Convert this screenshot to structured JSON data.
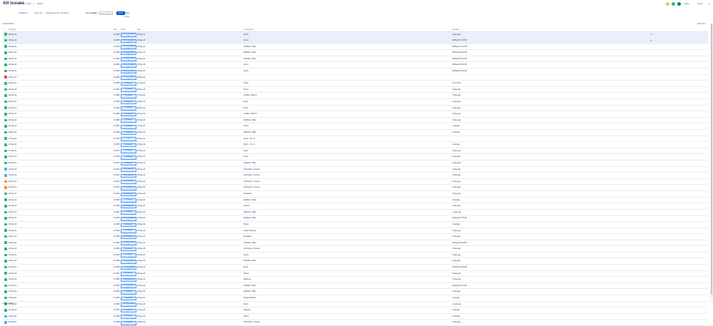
{
  "header": {
    "title": "All issues",
    "save_label": "Save",
    "share_label": "Share",
    "detail_label": "Details",
    "right_actions": [
      "Share",
      "Export",
      "•••"
    ],
    "status_dots": [
      "#f6c342",
      "#36b37e",
      "#00875a"
    ]
  },
  "filters": {
    "chips": [
      "All Status ▾",
      "Type: All ▾",
      "Assignee(s): Zhu Yun(exit) ▾",
      "Reporter: All ▾",
      "+ More"
    ],
    "search_placeholder": "Search issues",
    "search_button": "Search",
    "advanced_link": "Switch to JQL"
  },
  "list": {
    "count_label": "1-40 of 40 ⟳",
    "columns_label": "Columns ▾",
    "headers": [
      "T",
      "Summary",
      "Key",
      "Status",
      "Due",
      "Components",
      "Updated"
    ],
    "rows": [
      {
        "type": "story",
        "summary": "28-Sep-22",
        "key": "IC-3896",
        "status": "TODO ESTIMATE DATE",
        "due": "28-Sep-22",
        "component": "Scrum",
        "updated": "3 days ago"
      },
      {
        "type": "story",
        "summary": "28-Sep-22",
        "key": "IC-3895",
        "status": "TODO ESTIMATE DATE",
        "due": "28-Sep-22",
        "component": "Scrum",
        "updated": "28/Sep/22 3:25 PM"
      },
      {
        "type": "story",
        "summary": "28-Sep-22",
        "key": "IC-3894",
        "status": "TODO ESTIMATE DATE",
        "due": "28-Sep-22",
        "component": "Workflow / Table",
        "updated": "28/Sep/22 2:17 PM"
      },
      {
        "type": "story",
        "summary": "28-Sep-22",
        "key": "IC-3893",
        "status": "TODO ESTIMATE DATE",
        "due": "28-Sep-22",
        "component": "Workflow / Table",
        "updated": "28/Sep/22 2:06 PM"
      },
      {
        "type": "story",
        "summary": "28-Sep-22",
        "key": "IC-3892",
        "status": "TODO ESTIMATE DATE",
        "due": "28-Sep-22",
        "component": "Workflow / Table",
        "updated": "28/Sep/22 8:41 AM"
      },
      {
        "type": "story",
        "summary": "28-Sep-22",
        "key": "IC-3891",
        "status": "TODO ESTIMATE DATE",
        "due": "28-Sep-22",
        "component": "Scrum",
        "updated": "28/Sep/22 8:03 AM"
      },
      {
        "type": "story",
        "summary": "28-Sep-22",
        "key": "IC-3890",
        "status": "TODO ESTIMATE DATE",
        "due": "28-Sep-22",
        "component": "Scrum",
        "updated": "28/Sep/22 8:00 AM"
      },
      {
        "type": "bug",
        "summary": "28-Sep-22",
        "key": "IC-3889",
        "status": "TODO ESTIMATE DATE",
        "due": "28-Sep-22",
        "component": "",
        "updated": ""
      },
      {
        "type": "story",
        "summary": "28-Sep-22",
        "key": "IC-3888",
        "status": "IN DESIGN",
        "due": "11-Sep-22",
        "component": "Scrum",
        "updated": "21 17 Sims"
      },
      {
        "type": "story",
        "summary": "28-Sep-22",
        "key": "IC-3887",
        "status": "IN DESIGN",
        "due": "08-Sep-22",
        "component": "Scrum",
        "updated": "5 days ago"
      },
      {
        "type": "story",
        "summary": "28-Sep-22",
        "key": "IC-3886",
        "status": "IN DESIGN",
        "due": "07-Sep-22",
        "component": "Lockbox / Branch",
        "updated": "5 days ago"
      },
      {
        "type": "story",
        "summary": "28-Sep-22",
        "key": "IC-3885",
        "status": "IN DESIGN",
        "due": "06-Sep-22",
        "component": "Errors",
        "updated": "5 days ago"
      },
      {
        "type": "story",
        "summary": "28-Sep-22",
        "key": "IC-3884",
        "status": "IN DESIGN",
        "due": "06-Sep-22",
        "component": "Errors",
        "updated": "5 days ago"
      },
      {
        "type": "story",
        "summary": "28-Sep-22",
        "key": "IC-3883",
        "status": "IN DESIGN",
        "due": "06-Sep-22",
        "component": "Lockbox / Branch",
        "updated": "5 days ago"
      },
      {
        "type": "story",
        "summary": "28-Sep-22",
        "key": "IC-3882",
        "status": "IN DESIGN",
        "due": "06-Sep-22",
        "component": "Workflow / Table",
        "updated": "5 days ago"
      },
      {
        "type": "story",
        "summary": "28-Sep-22",
        "key": "IC-3881",
        "status": "IN DESIGN",
        "due": "06-Sep-22",
        "component": "Scrum",
        "updated": "Yesterday"
      },
      {
        "type": "story",
        "summary": "28-Sep-22",
        "key": "IC-3880",
        "status": "IN DESIGN",
        "due": "06-Sep-22",
        "component": "Workflow / Table",
        "updated": "Yesterday"
      },
      {
        "type": "story",
        "summary": "27-Sep-22",
        "key": "IC-3879",
        "status": "DEV",
        "due": "06-Sep-22",
        "component": "Sprint – 23 / 11",
        "updated": ""
      },
      {
        "type": "story",
        "summary": "27-Sep-22",
        "key": "IC-3878",
        "status": "IN DESIGN",
        "due": "06-Sep-22",
        "component": "Sprint – 23 / 11",
        "updated": "Yesterday"
      },
      {
        "type": "story",
        "summary": "27-Sep-22",
        "key": "IC-3877",
        "status": "IN DESIGN",
        "due": "07-Sep-22",
        "component": "Other",
        "updated": "5 days ago"
      },
      {
        "type": "story",
        "summary": "26-Sep-22",
        "key": "IC-3876",
        "status": "IN DESIGN",
        "due": "06-Sep-22",
        "component": "Scrum",
        "updated": "5 days ago"
      },
      {
        "type": "story",
        "summary": "26-Sep-22",
        "key": "IC-3875",
        "status": "IN DESIGN",
        "due": "06-Sep-22",
        "component": "Workflow / Table",
        "updated": "5 days ago"
      },
      {
        "type": "task",
        "summary": "26-Sep-22",
        "key": "IC-3874",
        "status": "IN ESTIMATION",
        "due": "06-Sep-22",
        "component": "Information / Courses",
        "updated": "5 days ago"
      },
      {
        "type": "task",
        "summary": "26-Sep-22",
        "key": "IC-3873",
        "status": "IN ESTIMATION",
        "due": "06-Sep-22",
        "component": "Information / Courses",
        "updated": "5 days ago"
      },
      {
        "type": "improve",
        "summary": "26-Sep-22",
        "key": "IC-3872",
        "status": "IN ESTIMATION",
        "due": "06-Sep-22",
        "component": "Information / Courses",
        "updated": "5 days ago"
      },
      {
        "type": "improve",
        "summary": "26-Sep-22",
        "key": "IC-3871",
        "status": "IN ESTIMATION",
        "due": "06-Sep-22",
        "component": "Information / Courses",
        "updated": "5 days ago"
      },
      {
        "type": "story",
        "summary": "26-Sep-22",
        "key": "IC-3870",
        "status": "IN ESTIMATION",
        "due": "06-Sep-22",
        "component": "Escalation",
        "updated": "5 days ago"
      },
      {
        "type": "story",
        "summary": "26-Sep-22",
        "key": "IC-3869",
        "status": "IN DESIGN",
        "due": "11-Sep-22",
        "component": "Workflow / Table",
        "updated": "Yesterday"
      },
      {
        "type": "story",
        "summary": "26-Sep-22",
        "key": "IC-3868",
        "status": "IN ESTIMATION",
        "due": "06-Sep-22",
        "component": "Security",
        "updated": "5 days ago"
      },
      {
        "type": "story",
        "summary": "26-Sep-22",
        "key": "IC-3867",
        "status": "IN DESIGN",
        "due": "06-Sep-22",
        "component": "Workflow / Table",
        "updated": "1 week ago"
      },
      {
        "type": "story",
        "summary": "26-Sep-22",
        "key": "IC-3866",
        "status": "TODO ESTIMATE DATE",
        "due": "26-Sep-22",
        "component": "Workflow / Table",
        "updated": "26/Sep/22 7:56 PM"
      },
      {
        "type": "story",
        "summary": "26-Sep-22",
        "key": "IC-3865",
        "status": "IN DESIGN",
        "due": "06-Sep-22",
        "component": "History",
        "updated": "Yesterday"
      },
      {
        "type": "story",
        "summary": "26-Sep-22",
        "key": "IC-3864",
        "status": "IN DESIGN",
        "due": "06-Sep-22",
        "component": "Project Estimate",
        "updated": "5 days ago"
      },
      {
        "type": "story",
        "summary": "23-Sep-22",
        "key": "IC-3863",
        "status": "IN ESTIMATION",
        "due": "06-Sep-22",
        "component": "Escalation",
        "updated": "5 days ago"
      },
      {
        "type": "story",
        "summary": "23-Sep-22",
        "key": "IC-3862",
        "status": "TODO ESTIMATE DATE",
        "due": "23-Sep-22",
        "component": "Workflow / Table",
        "updated": "23/Sep/22 3:09 PM"
      },
      {
        "type": "story",
        "summary": "23-Sep-22",
        "key": "IC-3861",
        "status": "IN DESIGN",
        "due": "06-Sep-22",
        "component": "Information / Courses",
        "updated": "5 days ago"
      },
      {
        "type": "story",
        "summary": "23-Sep-22",
        "key": "IC-3860",
        "status": "IN DESIGN",
        "due": "06-Sep-22",
        "component": "Scrum",
        "updated": "5 days ago"
      },
      {
        "type": "story",
        "summary": "23-Sep-22",
        "key": "IC-3859",
        "status": "TODO ESTIMATE DATE",
        "due": "23-Sep-22",
        "component": "Workflow / Table",
        "updated": "5 days ago"
      },
      {
        "type": "story",
        "summary": "23-Sep-22",
        "key": "IC-3858",
        "status": "TODO ESTIMATE DATE",
        "due": "23-Sep-22",
        "component": "Errors",
        "updated": "23/Sep/22 2:05 PM"
      },
      {
        "type": "story",
        "summary": "23-Sep-22",
        "key": "IC-3857",
        "status": "IN DESIGN",
        "due": "06-Sep-22",
        "component": "History",
        "updated": "5 days ago"
      },
      {
        "type": "story",
        "summary": "23-Sep-22",
        "key": "IC-3856",
        "status": "IN ESTIMATION",
        "due": "06-Sep-22",
        "component": "Milestone",
        "updated": "1 week ago"
      },
      {
        "type": "story",
        "summary": "23-Sep-22",
        "key": "IC-3855",
        "status": "TODO ESTIMATE DATE",
        "due": "23-Sep-22",
        "component": "Workflow / Table",
        "updated": "23/Sep/22 1:01 PM"
      },
      {
        "type": "story",
        "summary": "23-Sep-22",
        "key": "IC-3854",
        "status": "IN DESIGN",
        "due": "06-Sep-22",
        "component": "Workflow / Table",
        "updated": "5 days ago"
      },
      {
        "type": "story",
        "summary": "23-Sep-22",
        "key": "IC-3853",
        "status": "IN DESIGN",
        "due": "11-Sep-22",
        "component": "Project Estimate",
        "updated": "Yesterday"
      },
      {
        "type": "story",
        "summary": "23-Sep-22",
        "key": "IC-3852",
        "status": "TODO ESTIMATE DATE",
        "due": "23-Sep-22",
        "component": "Errors",
        "updated": "1 week ago"
      },
      {
        "type": "story",
        "summary": "23-Sep-22",
        "key": "IC-3851",
        "status": "IN DESIGN",
        "due": "06-Sep-22",
        "component": "Calendar",
        "updated": "Yesterday"
      },
      {
        "type": "task",
        "summary": "23-Sep-22",
        "key": "IC-3850",
        "status": "IN DESIGN",
        "due": "06-Sep-22",
        "component": "History",
        "updated": "Yesterday"
      },
      {
        "type": "task",
        "summary": "23-Sep-22",
        "key": "IC-3849",
        "status": "IN DESIGN",
        "due": "06-Sep-22",
        "component": "Information / Courses",
        "updated": "5 days ago"
      }
    ],
    "footer_label": "1-40 of 40 ⟳"
  },
  "type_colors": {
    "story": "#36b37e",
    "bug": "#e5493a",
    "task": "#4bade8",
    "improve": "#ff8b00"
  }
}
